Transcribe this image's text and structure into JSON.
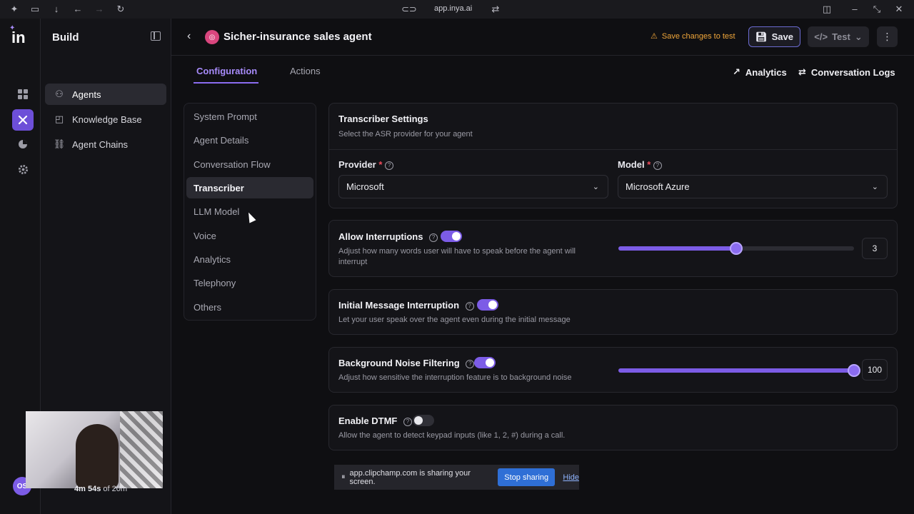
{
  "browser": {
    "url": "app.inya.ai"
  },
  "rail": {
    "logo": "in",
    "avatar": "OS",
    "icons": [
      "grid-icon",
      "tools-icon",
      "pie-chart-icon",
      "gear-icon"
    ]
  },
  "sidebar": {
    "title": "Build",
    "items": [
      {
        "label": "Agents",
        "icon": "agents-icon",
        "active": true
      },
      {
        "label": "Knowledge Base",
        "icon": "book-icon",
        "active": false
      },
      {
        "label": "Agent Chains",
        "icon": "chain-icon",
        "active": false
      }
    ]
  },
  "header": {
    "agent_name": "Sicher-insurance sales agent",
    "warning": "Save changes to test",
    "save_label": "Save",
    "test_label": "Test",
    "warning_color": "#f0a63a",
    "accent": "#7c5ce6"
  },
  "tabs": {
    "items": [
      "Configuration",
      "Actions"
    ],
    "active": "Configuration",
    "analytics_label": "Analytics",
    "logs_label": "Conversation Logs"
  },
  "config_menu": {
    "items": [
      "System Prompt",
      "Agent Details",
      "Conversation Flow",
      "Transcriber",
      "LLM Model",
      "Voice",
      "Analytics",
      "Telephony",
      "Others"
    ],
    "active": "Transcriber"
  },
  "transcriber": {
    "title": "Transcriber Settings",
    "subtitle": "Select the ASR provider for your agent",
    "provider_label": "Provider",
    "provider_value": "Microsoft",
    "model_label": "Model",
    "model_value": "Microsoft Azure",
    "required_mark": "*"
  },
  "interruptions": {
    "title": "Allow Interruptions",
    "desc": "Adjust how many words user will have to speak before the agent will interrupt",
    "enabled": true,
    "value": "3",
    "slider_fraction": 0.5
  },
  "initial_message": {
    "title": "Initial Message Interruption",
    "desc": "Let your user speak over the agent even during the initial message",
    "enabled": true
  },
  "noise": {
    "title": "Background Noise Filtering",
    "desc": "Adjust how sensitive the interruption feature is to background noise",
    "enabled": true,
    "value": "100",
    "slider_fraction": 1.0
  },
  "dtmf": {
    "title": "Enable DTMF",
    "desc": "Allow the agent to detect keypad inputs (like 1, 2, #) during a call.",
    "enabled": false
  },
  "recording": {
    "timer_bold": "4m 54s",
    "timer_rest": "of 20m"
  },
  "sharebar": {
    "message": "app.clipchamp.com is sharing your screen.",
    "stop_label": "Stop sharing",
    "hide_label": "Hide"
  }
}
